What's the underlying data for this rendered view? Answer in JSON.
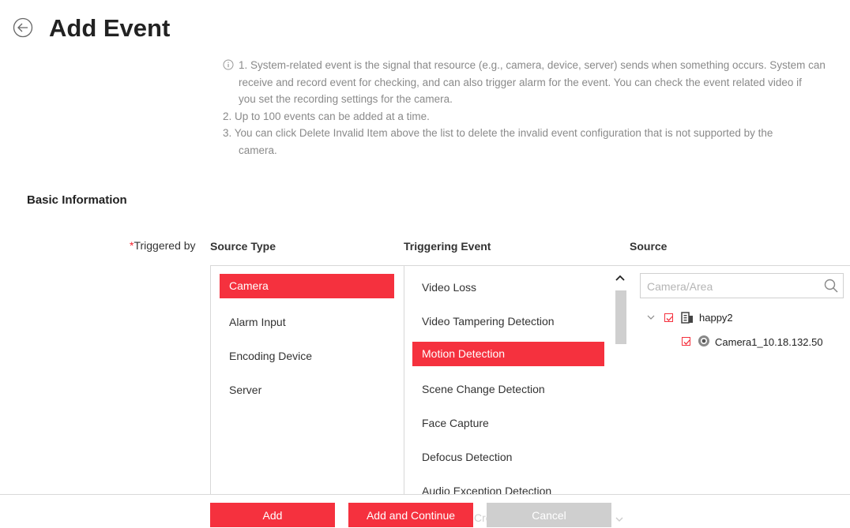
{
  "header": {
    "title": "Add Event"
  },
  "notes": [
    "1. System-related event is the signal that resource (e.g., camera, device, server) sends when something occurs. System can",
    "receive and record event for checking, and can also trigger alarm for the event. You can check the event related video if",
    "you set the recording settings for the camera.",
    "2. Up to 100 events can be added at a time.",
    "3. You can click Delete Invalid Item above the list to delete the invalid event configuration that is not supported by the",
    "camera."
  ],
  "section": {
    "basic_info": "Basic Information"
  },
  "form": {
    "required_mark": "*",
    "triggered_by": "Triggered by"
  },
  "columns": {
    "source_type": "Source Type",
    "triggering_event": "Triggering Event",
    "source": "Source"
  },
  "source_types": [
    "Camera",
    "Alarm Input",
    "Encoding Device",
    "Server"
  ],
  "triggering_events": [
    "Video Loss",
    "Video Tampering Detection",
    "Motion Detection",
    "Scene Change Detection",
    "Face Capture",
    "Defocus Detection",
    "Audio Exception Detection"
  ],
  "selected": {
    "source_type": "Camera",
    "triggering_event": "Motion Detection"
  },
  "search": {
    "placeholder": "Camera/Area"
  },
  "tree": {
    "area": "happy2",
    "camera": "Camera1_10.18.132.50"
  },
  "buttons": {
    "add": "Add",
    "add_continue": "Add and Continue",
    "cancel": "Cancel"
  },
  "ghost": {
    "text": "Cre"
  },
  "colors": {
    "accent": "#f5313e",
    "cancel": "#cfcfcf"
  }
}
